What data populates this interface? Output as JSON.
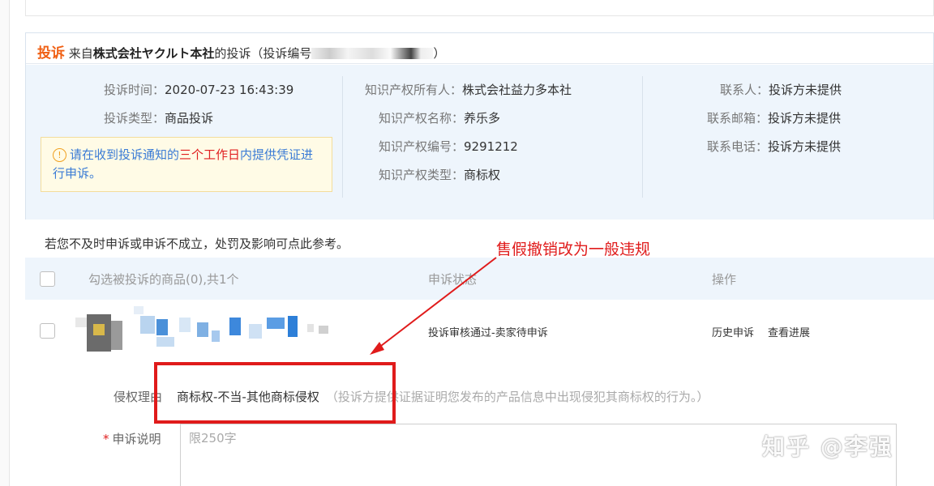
{
  "complaint": {
    "tag": "投诉",
    "from_prefix": "来自",
    "company": "株式会社ヤクルト本社",
    "suffix": "的投诉（投诉编号",
    "id_masked": "",
    "close": "）"
  },
  "complaint_info": {
    "time_label": "投诉时间：",
    "time_value": "2020-07-23 16:43:39",
    "type_label": "投诉类型：",
    "type_value": "商品投诉",
    "owner_label": "知识产权所有人：",
    "owner_value": "株式会社益力多本社",
    "ip_name_label": "知识产权名称：",
    "ip_name_value": "养乐多",
    "ip_number_label": "知识产权编号：",
    "ip_number_value": "9291212",
    "ip_type_label": "知识产权类型：",
    "ip_type_value": "商标权",
    "contact_label": "联系人：",
    "contact_value": "投诉方未提供",
    "email_label": "联系邮箱：",
    "email_value": "投诉方未提供",
    "phone_label": "联系电话：",
    "phone_value": "投诉方未提供"
  },
  "notice": {
    "icon": "!",
    "part1": "请在收到投诉通知的",
    "highlight": "三个工作日",
    "part2": "内提供凭证进行申诉。"
  },
  "reference_text": "若您不及时申诉或申诉不成立，处罚及影响可点此参考。",
  "table": {
    "col_product": "勾选被投诉的商品(0),共1个",
    "col_status": "申诉状态",
    "col_action": "操作",
    "row": {
      "status": "投诉审核通过-卖家待申诉",
      "history_link": "历史申诉",
      "progress_link": "查看进展"
    }
  },
  "infringement": {
    "label": "侵权理由",
    "value": "商标权-不当-其他商标侵权",
    "description": "（投诉方提供证据证明您发布的产品信息中出现侵犯其商标权的行为。）"
  },
  "appeal": {
    "required_mark": "*",
    "label": "申诉说明",
    "placeholder": "限250字"
  },
  "annotation_text": "售假撤销改为一般违规",
  "watermark": "知乎 @李强",
  "colors": {
    "accent_orange": "#f06014",
    "annotation_red": "#e01b1b",
    "info_bg": "#eef5fc",
    "notice_bg": "#fffbe6"
  }
}
